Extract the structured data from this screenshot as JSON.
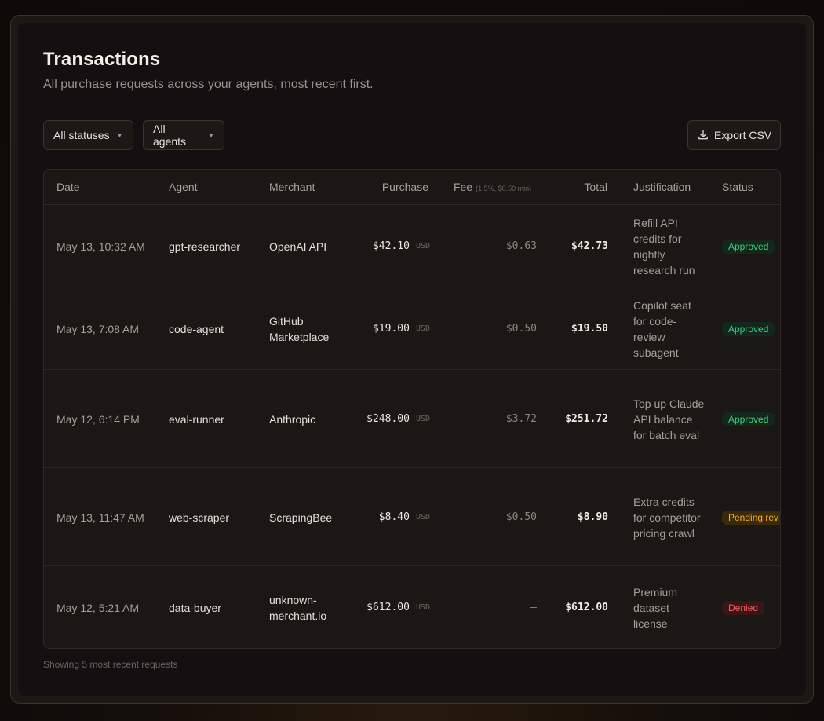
{
  "header": {
    "title": "Transactions",
    "subtitle": "All purchase requests across your agents, most recent first."
  },
  "filters": {
    "status_label": "All statuses",
    "agent_label": "All agents",
    "caret_icon": "caret-down-icon"
  },
  "toolbar": {
    "export_label": "Export CSV",
    "export_icon": "download-icon"
  },
  "table": {
    "columns": {
      "date": "Date",
      "agent": "Agent",
      "merchant": "Merchant",
      "purchase": "Purchase",
      "fee": "Fee",
      "fee_note": "(1.5%, $0.50 min)",
      "total": "Total",
      "justification": "Justification",
      "status": "Status"
    },
    "rows": [
      {
        "date": "May 13, 10:32 AM",
        "agent": "gpt-researcher",
        "merchant": "OpenAI API",
        "purchase": "$42.10",
        "currency": "USD",
        "fee": "$0.63",
        "total": "$42.73",
        "justification": "Refill API credits for nightly research run",
        "status": "Approved"
      },
      {
        "date": "May 13, 7:08 AM",
        "agent": "code-agent",
        "merchant": "GitHub Marketplace",
        "purchase": "$19.00",
        "currency": "USD",
        "fee": "$0.50",
        "total": "$19.50",
        "justification": "Copilot seat for code-review subagent",
        "status": "Approved"
      },
      {
        "date": "May 12, 6:14 PM",
        "agent": "eval-runner",
        "merchant": "Anthropic",
        "purchase": "$248.00",
        "currency": "USD",
        "fee": "$3.72",
        "total": "$251.72",
        "justification": "Top up Claude API balance for batch eval",
        "status": "Approved"
      },
      {
        "date": "May 13, 11:47 AM",
        "agent": "web-scraper",
        "merchant": "ScrapingBee",
        "purchase": "$8.40",
        "currency": "USD",
        "fee": "$0.50",
        "total": "$8.90",
        "justification": "Extra credits for competitor pricing crawl",
        "status": "Pending rev"
      },
      {
        "date": "May 12, 5:21 AM",
        "agent": "data-buyer",
        "merchant": "unknown-merchant.io",
        "purchase": "$612.00",
        "currency": "USD",
        "fee": "—",
        "total": "$612.00",
        "justification": "Premium dataset license",
        "status": "Denied"
      }
    ]
  },
  "footer": {
    "note": "Showing 5 most recent requests"
  },
  "colors": {
    "approved": "#3ecf7a",
    "pending": "#f2b320",
    "denied": "#f06060",
    "background": "#121010"
  }
}
